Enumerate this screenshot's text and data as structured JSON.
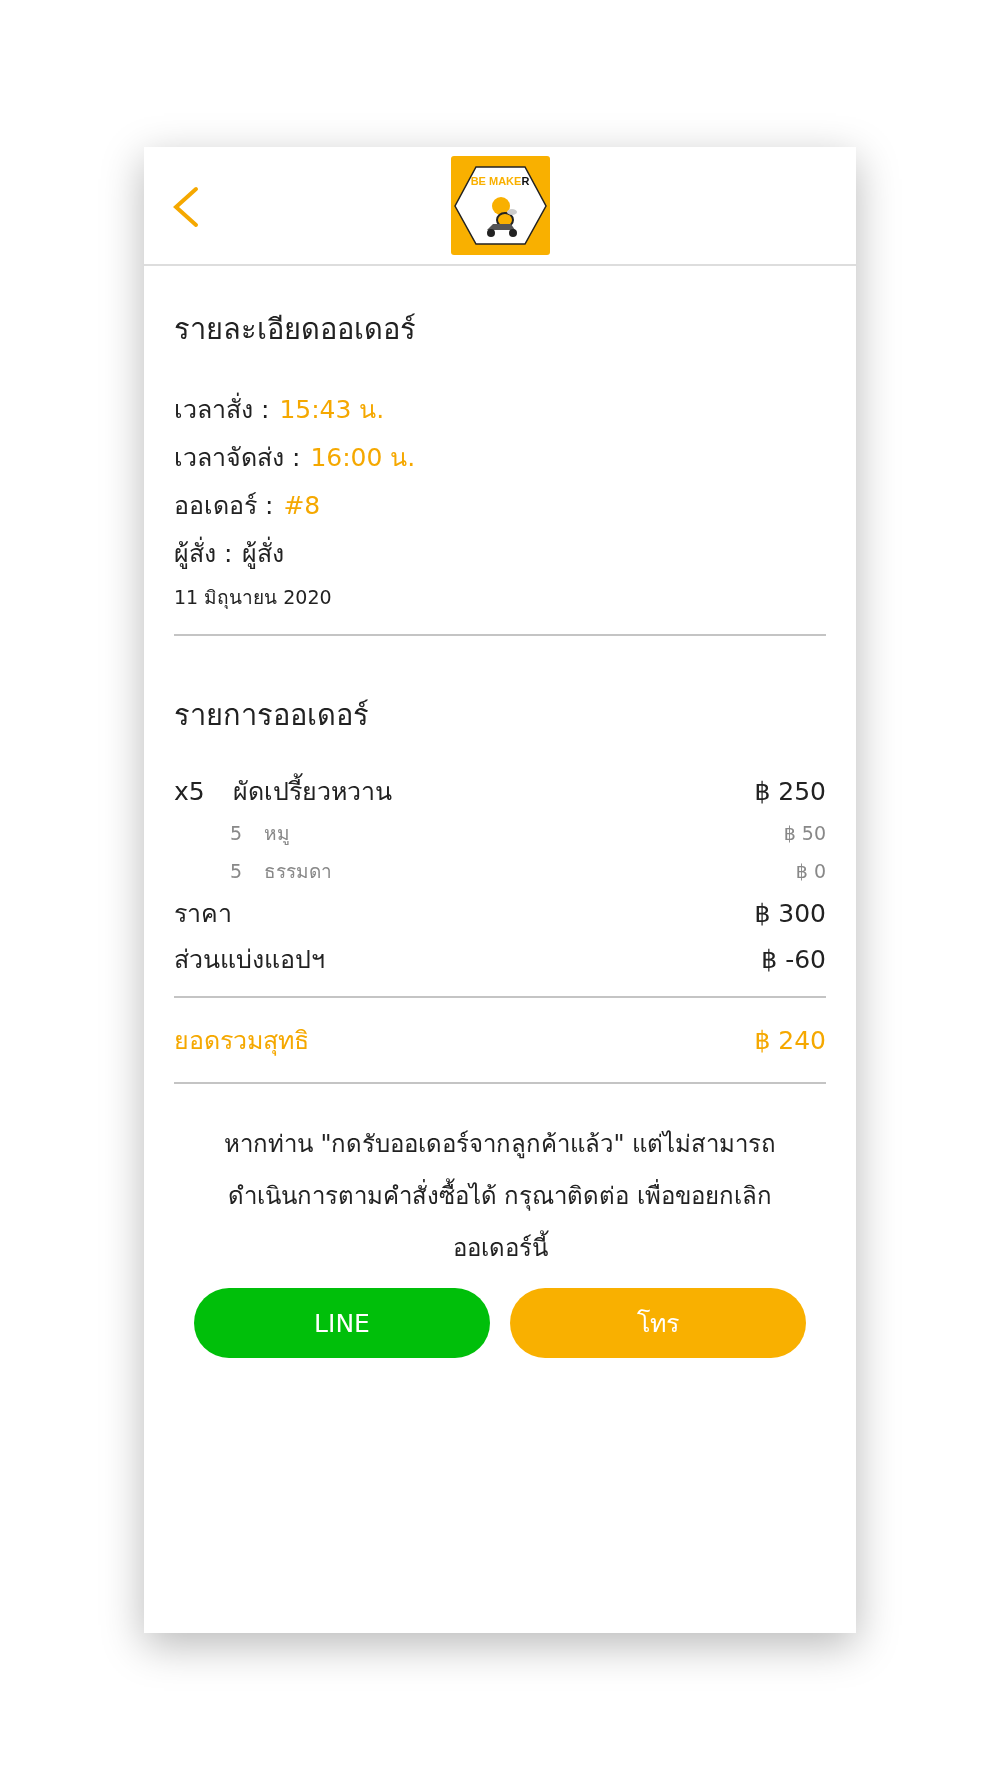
{
  "header": {
    "logo": {
      "text_accent": "BE MAKE",
      "text_plain": "R"
    }
  },
  "order_details": {
    "title": "รายละเอียดออเดอร์",
    "fields": [
      {
        "label": "เวลาสั่ง :",
        "value": "15:43 น.",
        "highlight": true
      },
      {
        "label": "เวลาจัดส่ง :",
        "value": "16:00 น.",
        "highlight": true
      },
      {
        "label": "ออเดอร์ :",
        "value": "#8",
        "highlight": true
      },
      {
        "label": "ผู้สั่ง :",
        "value": "ผู้สั่ง",
        "highlight": false
      }
    ],
    "date": "11 มิถุนายน 2020"
  },
  "order_items": {
    "title": "รายการออเดอร์",
    "items": [
      {
        "qty": "x5",
        "name": "ผัดเปรี้ยวหวาน",
        "price": "฿ 250",
        "options": [
          {
            "qty": "5",
            "name": "หมู",
            "price": "฿ 50"
          },
          {
            "qty": "5",
            "name": "ธรรมดา",
            "price": "฿ 0"
          }
        ]
      }
    ],
    "summary": [
      {
        "label": "ราคา",
        "value": "฿ 300"
      },
      {
        "label": "ส่วนแบ่งแอปฯ",
        "value": "฿ -60"
      }
    ],
    "total": {
      "label": "ยอดรวมสุทธิ",
      "value": "฿ 240"
    }
  },
  "notice": "หากท่าน \"กดรับออเดอร์จากลูกค้าแล้ว\" แต่ไม่สามารถดำเนินการตามคำสั่งซื้อได้ กรุณาติดต่อ เพื่อขอยกเลิกออเดอร์นี้",
  "buttons": [
    {
      "label": "LINE",
      "kind": "line"
    },
    {
      "label": "โทร",
      "kind": "call"
    }
  ]
}
